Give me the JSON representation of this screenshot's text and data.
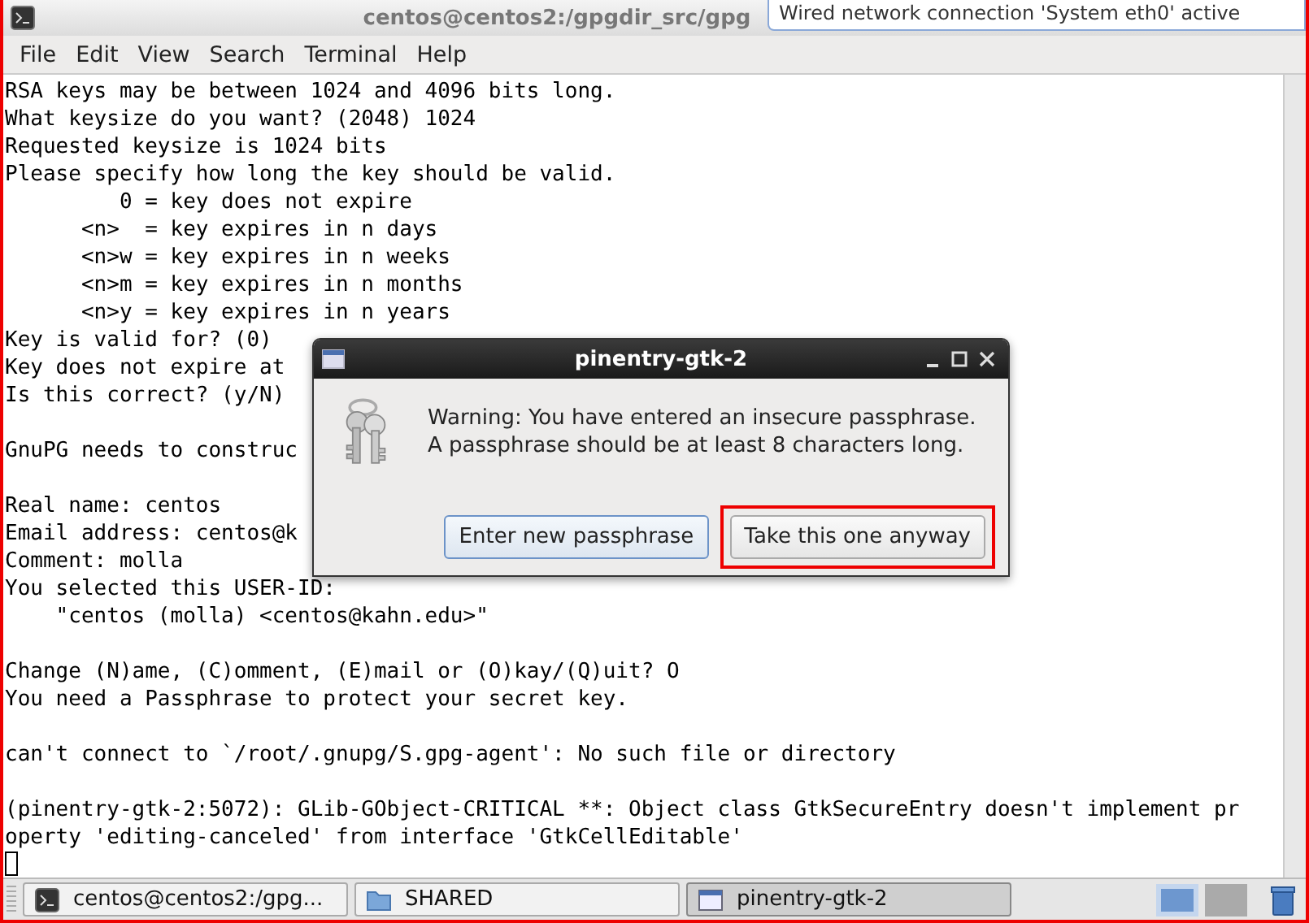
{
  "window": {
    "title": "centos@centos2:/gpgdir_src/gpg"
  },
  "notification": {
    "text": "Wired network connection 'System eth0' active"
  },
  "menu": [
    {
      "label": "File"
    },
    {
      "label": "Edit"
    },
    {
      "label": "View"
    },
    {
      "label": "Search"
    },
    {
      "label": "Terminal"
    },
    {
      "label": "Help"
    }
  ],
  "terminal": {
    "blocks": [
      [
        "RSA keys may be between 1024 and 4096 bits long.",
        "What keysize do you want? (2048) 1024",
        "Requested keysize is 1024 bits",
        "Please specify how long the key should be valid.",
        "         0 = key does not expire",
        "      <n>  = key expires in n days",
        "      <n>w = key expires in n weeks",
        "      <n>m = key expires in n months",
        "      <n>y = key expires in n years",
        "Key is valid for? (0)",
        "Key does not expire at",
        "Is this correct? (y/N)"
      ],
      [
        "GnuPG needs to construc"
      ],
      [
        "Real name: centos",
        "Email address: centos@k",
        "Comment: molla",
        "You selected this USER-ID:",
        "    \"centos (molla) <centos@kahn.edu>\""
      ],
      [
        "Change (N)ame, (C)omment, (E)mail or (O)kay/(Q)uit? O",
        "You need a Passphrase to protect your secret key."
      ],
      [
        "can't connect to `/root/.gnupg/S.gpg-agent': No such file or directory"
      ],
      [
        "(pinentry-gtk-2:5072): GLib-GObject-CRITICAL **: Object class GtkSecureEntry doesn't implement pr",
        "operty 'editing-canceled' from interface 'GtkCellEditable'"
      ]
    ],
    "cursor": true
  },
  "dialog": {
    "title": "pinentry-gtk-2",
    "message_lines": [
      "Warning: You have entered an insecure passphrase.",
      "A passphrase should be at least 8 characters long."
    ],
    "buttons": [
      {
        "label": "Enter new passphrase",
        "focused": true,
        "highlighted": false
      },
      {
        "label": "Take this one anyway",
        "focused": false,
        "highlighted": true
      }
    ]
  },
  "taskbar": {
    "items": [
      {
        "label": "centos@centos2:/gpg...",
        "kind": "terminal",
        "selected": false
      },
      {
        "label": "SHARED",
        "kind": "folder",
        "selected": false
      },
      {
        "label": "pinentry-gtk-2",
        "kind": "window",
        "selected": true
      }
    ],
    "workspaces": [
      {
        "selected": true
      },
      {
        "selected": false
      }
    ]
  }
}
